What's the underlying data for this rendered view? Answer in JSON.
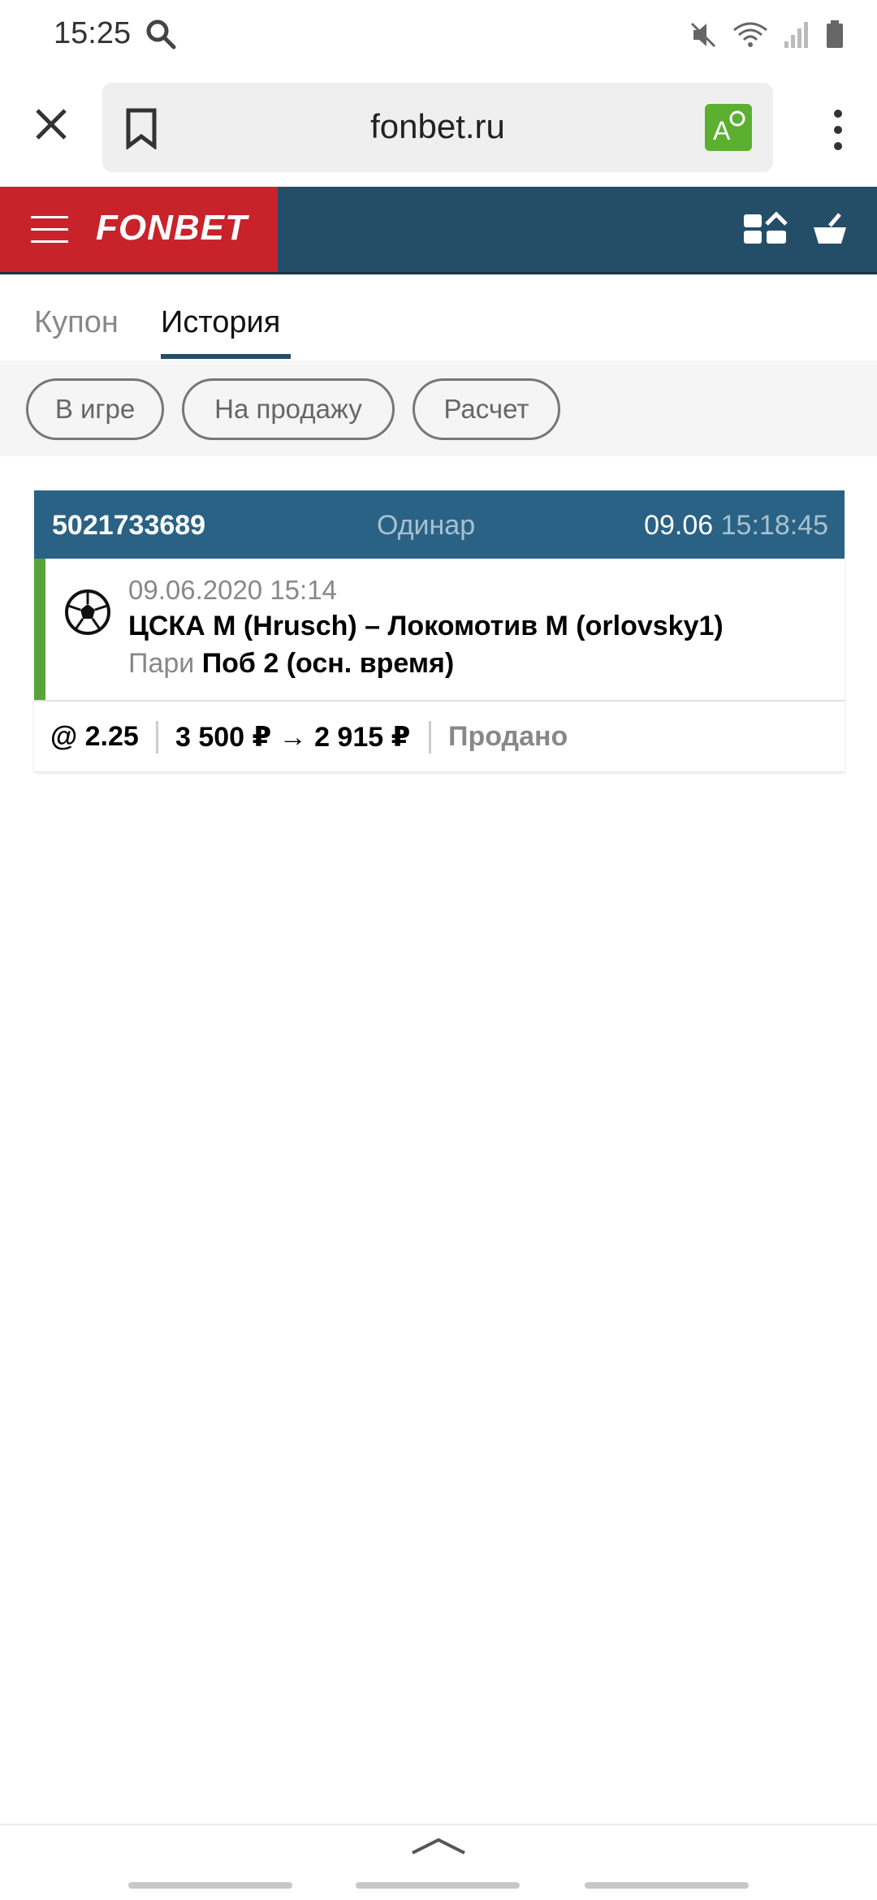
{
  "status_bar": {
    "time": "15:25"
  },
  "browser": {
    "url": "fonbet.ru"
  },
  "site": {
    "brand": "FONBET"
  },
  "tabs": [
    {
      "label": "Купон",
      "active": false
    },
    {
      "label": "История",
      "active": true
    }
  ],
  "filters": [
    {
      "label": "В игре"
    },
    {
      "label": "На продажу"
    },
    {
      "label": "Расчет"
    }
  ],
  "bet": {
    "id": "5021733689",
    "type": "Одинар",
    "date": "09.06",
    "time": "15:18:45",
    "event_datetime": "09.06.2020 15:14",
    "teams": "ЦСКА М (Hrusch) – Локомотив М (orlovsky1)",
    "pari_label": "Пари",
    "outcome": "Поб 2 (осн. время)",
    "coefficient": "@ 2.25",
    "amount": "3 500 ₽ → 2 915 ₽",
    "status": "Продано"
  },
  "colors": {
    "header_bg": "#244d68",
    "brand_red": "#c8232b",
    "card_head": "#2a6285",
    "sport_indicator": "#5aa23a"
  }
}
